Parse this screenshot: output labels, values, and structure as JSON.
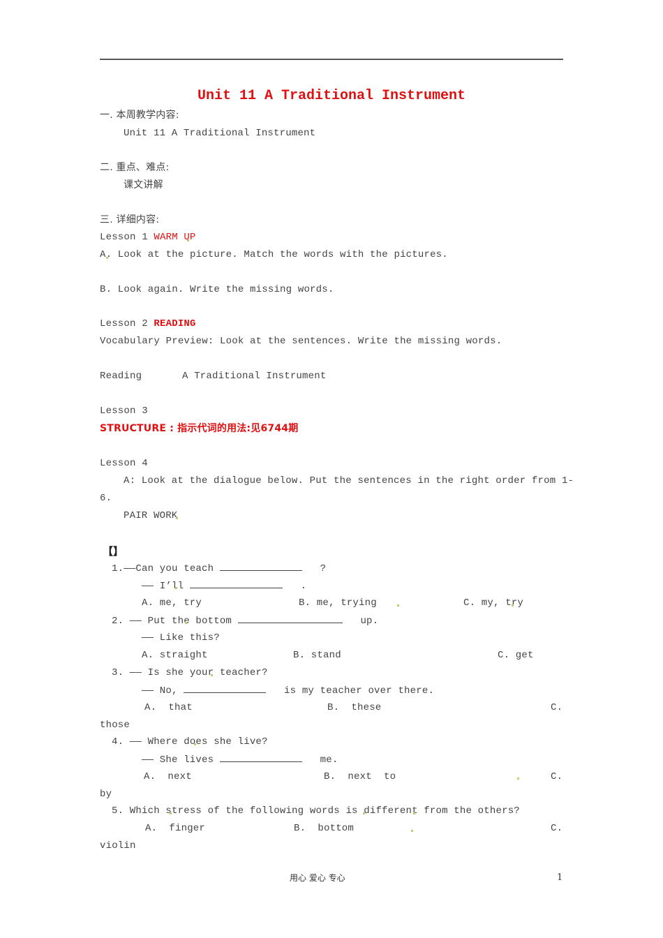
{
  "title": "Unit 11 A Traditional Instrument",
  "sections": {
    "s1_heading": "一. 本周教学内容:",
    "s1_body": "Unit 11 A Traditional Instrument",
    "s2_heading": "二. 重点、难点:",
    "s2_body": "课文讲解",
    "s3_heading": "三. 详细内容:"
  },
  "lesson1": {
    "label": "Lesson 1 ",
    "tag": "WARM UP",
    "a": "A. Look at the picture. Match the words with the pictures.",
    "b": "B. Look again. Write the missing words."
  },
  "lesson2": {
    "label": "Lesson 2 ",
    "tag": "READING",
    "vocab": "Vocabulary Preview: Look at the sentences. Write the missing words.",
    "reading_label": "Reading",
    "reading_title": "A Traditional Instrument"
  },
  "lesson3": {
    "label": "Lesson 3",
    "structure": "STRUCTURE : 指示代词的用法:见6744期"
  },
  "lesson4": {
    "label": "Lesson 4",
    "a_line1": "A: Look at the dialogue below. Put the sentences in the right order from 1-",
    "a_line2": "6.",
    "pair_work": "PAIR WORK"
  },
  "exercise": {
    "bracket": "【】",
    "questions": [
      {
        "q1": "1.——Can you teach",
        "q1_end": "?",
        "q2": "—— I’ll",
        "q2_end": ".",
        "a": "A. me, try",
        "b": "B. me, trying",
        "c": "C. my, try"
      },
      {
        "q1": "2. —— Put the bottom",
        "q1_end": "up.",
        "q2": "—— Like this?",
        "a": "A. straight",
        "b": "B. stand",
        "c": "C. get"
      },
      {
        "q1": "3. —— Is she your teacher?",
        "q2": "—— No,",
        "q2_end": "is my teacher over there.",
        "a": "A.  that",
        "b": "B.  these",
        "c": "C.",
        "c_wrap": "those"
      },
      {
        "q1": "4. —— Where does she live?",
        "q2": "—— She lives",
        "q2_end": "me.",
        "a": "A.  next",
        "b": "B.  next  to",
        "c": "C.",
        "c_wrap": "by"
      },
      {
        "q1": "5. Which stress of the following words is different from the others?",
        "a": "A.  finger",
        "b": "B.  bottom",
        "c": "C.",
        "c_wrap": "violin"
      }
    ]
  },
  "footer": {
    "motto": "用心 爱心 专心",
    "page_number": "1"
  }
}
